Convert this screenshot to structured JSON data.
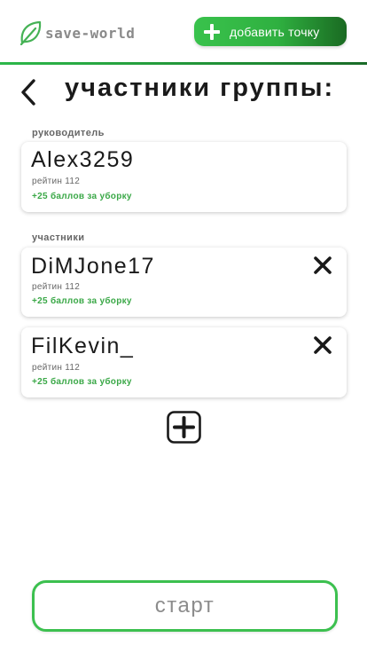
{
  "header": {
    "logo_text": "save-world",
    "logo_icon": "leaf-icon",
    "add_point_label": "добавить точку",
    "add_point_icon": "plus-icon",
    "accent_color": "#2fb040"
  },
  "title_row": {
    "back_icon": "chevron-left-icon",
    "title": "участники группы:"
  },
  "leader_section": {
    "label": "руководитель",
    "member": {
      "name": "Alex3259",
      "rating": "рейтин 112",
      "bonus": "+25 баллов за уборку"
    }
  },
  "members_section": {
    "label": "участники",
    "members": [
      {
        "name": "DiMJone17",
        "rating": "рейтин 112",
        "bonus": "+25 баллов за уборку",
        "remove_icon": "close-icon"
      },
      {
        "name": "FilKevin_",
        "rating": "рейтин 112",
        "bonus": "+25 баллов за уборку",
        "remove_icon": "close-icon"
      }
    ],
    "add_member_icon": "plus-square-icon"
  },
  "footer": {
    "start_label": "старт"
  }
}
